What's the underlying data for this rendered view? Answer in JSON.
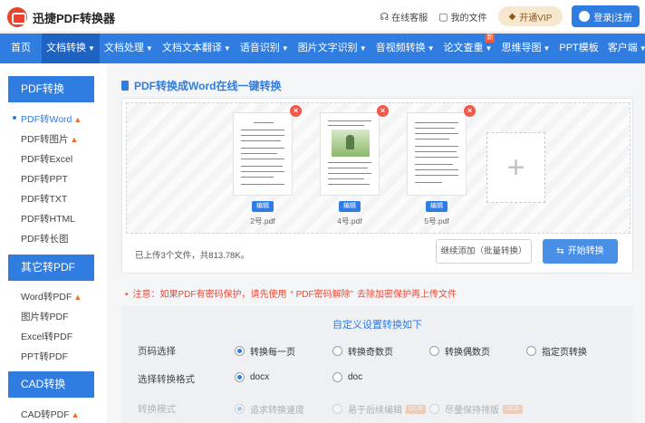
{
  "header": {
    "brand": "迅捷PDF转换器",
    "online_service": "在线客服",
    "my_files": "我的文件",
    "vip_button": "开通VIP",
    "login_button": "登录|注册"
  },
  "nav": {
    "items": [
      "首页",
      "文档转换",
      "文档处理",
      "文档文本翻译",
      "语音识别",
      "图片文字识别",
      "音视频转换",
      "论文查重",
      "思维导图",
      "PPT模板",
      "客户端"
    ],
    "new_badge": "新"
  },
  "sidebar": {
    "pdf_heading": "PDF转换",
    "pdf_items": [
      "PDF转Word",
      "PDF转图片",
      "PDF转Excel",
      "PDF转PPT",
      "PDF转TXT",
      "PDF转HTML",
      "PDF转长图"
    ],
    "other_heading": "其它转PDF",
    "other_items": [
      "Word转PDF",
      "图片转PDF",
      "Excel转PDF",
      "PPT转PDF"
    ],
    "cad_heading": "CAD转换",
    "cad_items": [
      "CAD转PDF"
    ]
  },
  "main": {
    "title": "PDF转换成Word在线一键转换",
    "files": [
      {
        "name": "2号.pdf",
        "edit": "编辑"
      },
      {
        "name": "4号.pdf",
        "edit": "编辑"
      },
      {
        "name": "5号.pdf",
        "edit": "编辑"
      }
    ],
    "upload_info": "已上传3个文件，共813.78K。",
    "continue_add": "继续添加（批量转换）",
    "start_convert": "开始转换",
    "notice_prefix": "注意：如果PDF有密码保护，请先使用",
    "notice_link": "“ PDF密码解除”",
    "notice_suffix": "去除加密保护再上传文件"
  },
  "settings": {
    "title": "自定义设置转换如下",
    "page_label": "页码选择",
    "page_options": [
      "转换每一页",
      "转换奇数页",
      "转换偶数页",
      "指定页转换"
    ],
    "format_label": "选择转换格式",
    "format_options": [
      "docx",
      "doc"
    ],
    "mode_label": "转换模式",
    "mode_options": [
      "追求转换速度",
      "易于后续编辑",
      "尽量保持排版"
    ],
    "ocr_badge": "OCR"
  },
  "colors": {
    "accent": "#2f7de1",
    "warning": "#e84b3a",
    "fire": "#f06b26"
  }
}
